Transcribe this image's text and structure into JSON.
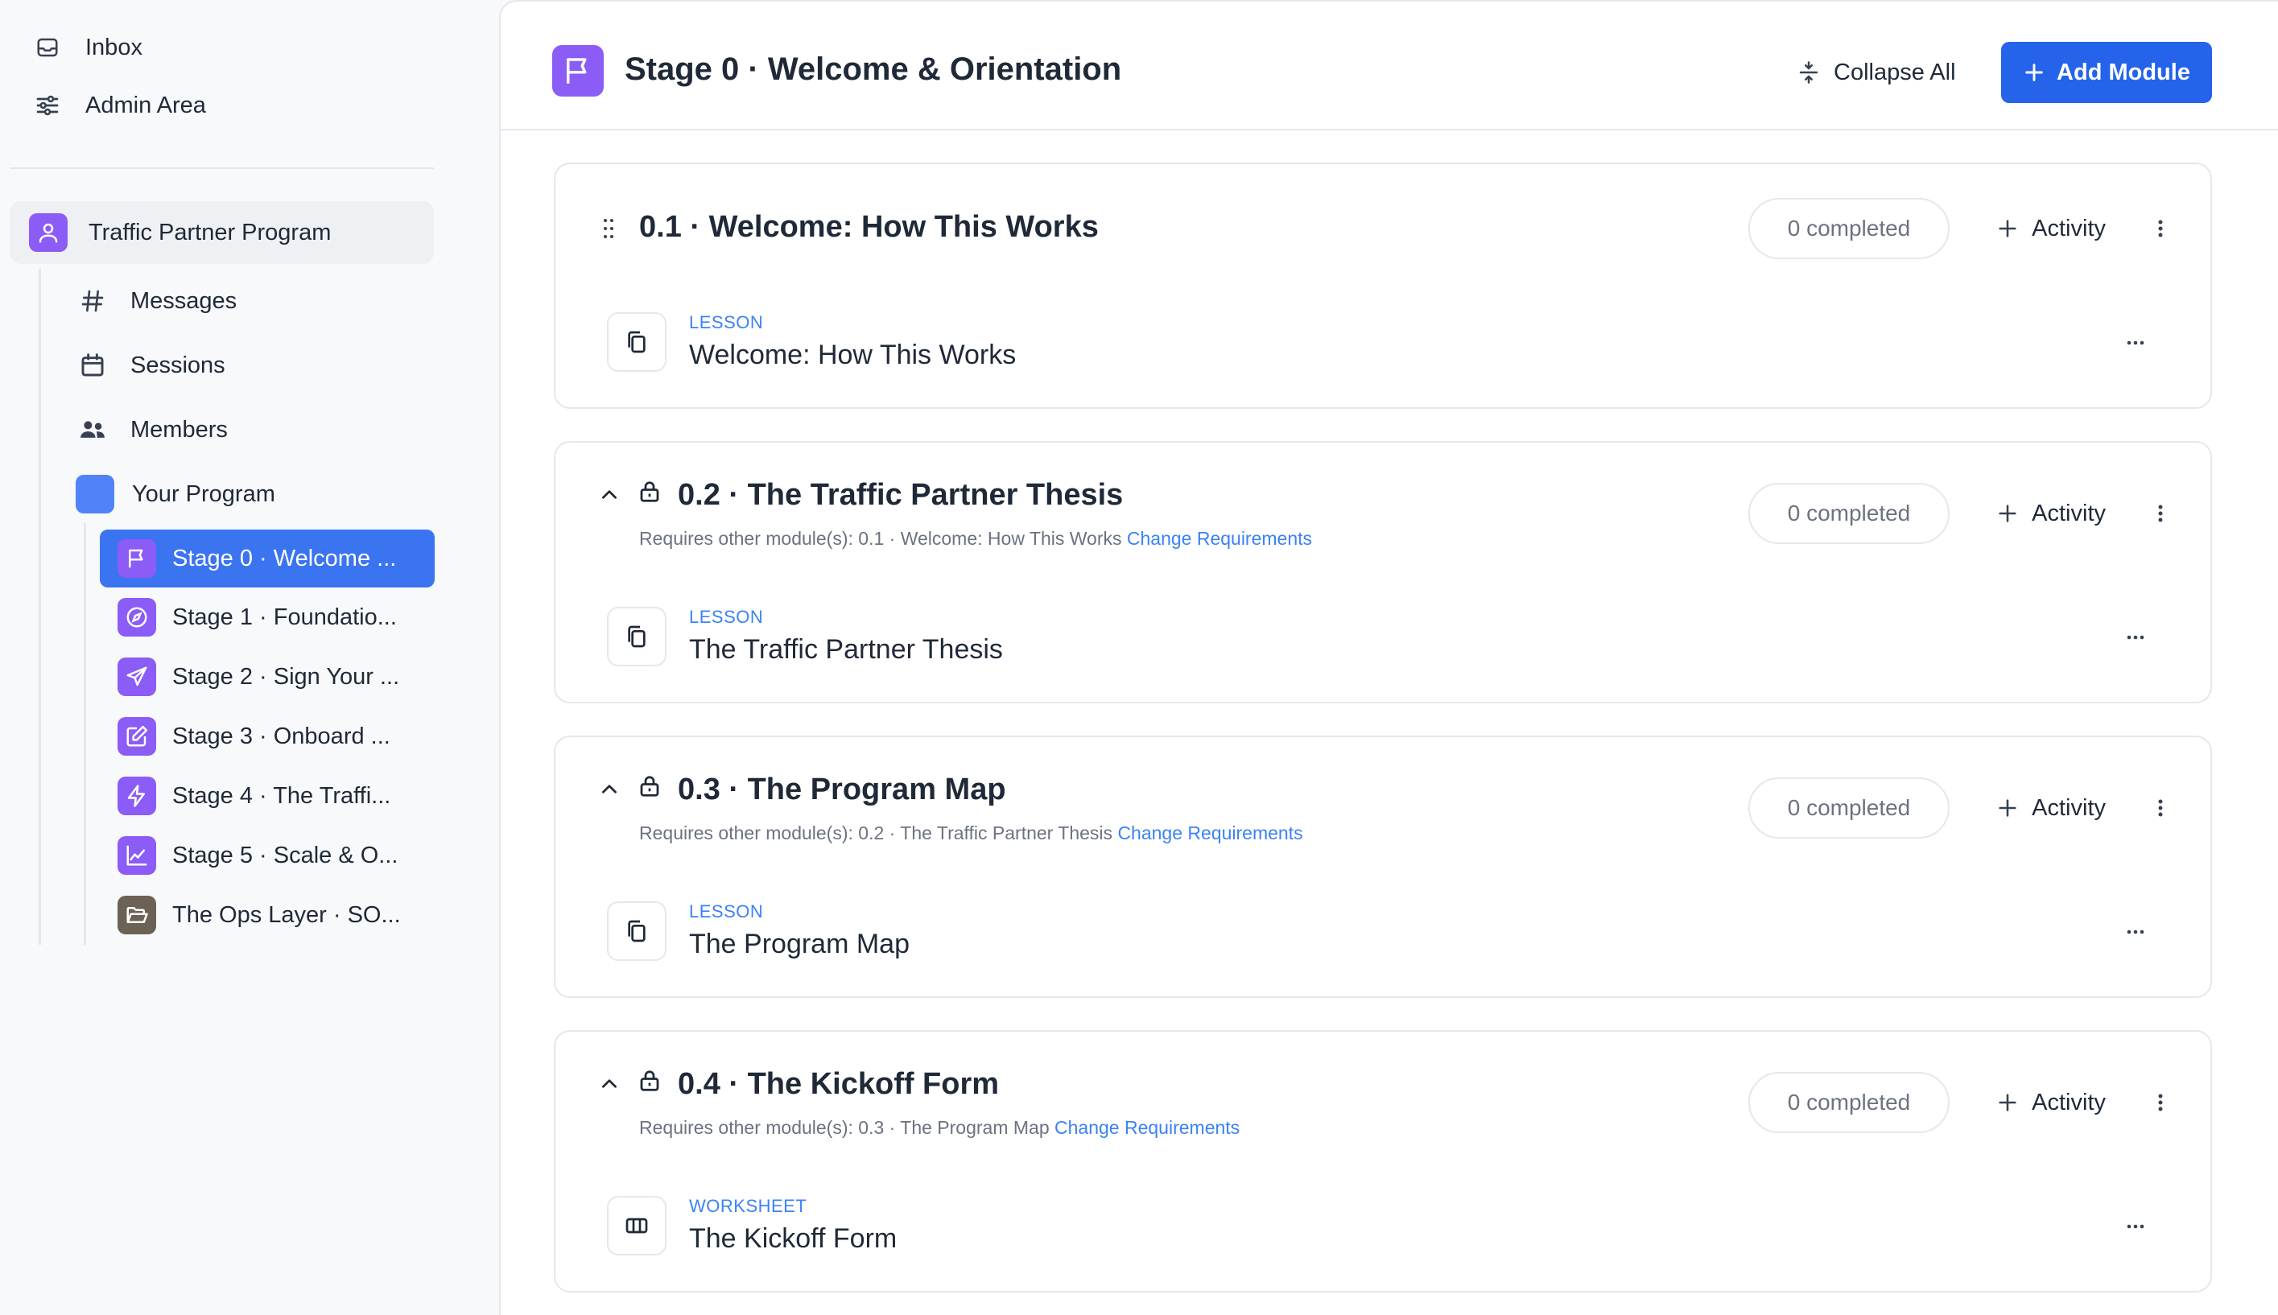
{
  "sidebar": {
    "top_items": [
      {
        "label": "Inbox",
        "icon": "inbox-icon"
      },
      {
        "label": "Admin Area",
        "icon": "sliders-icon"
      }
    ],
    "program": {
      "label": "Traffic Partner Program",
      "icon": "user-icon"
    },
    "nav": [
      {
        "label": "Messages",
        "icon": "hash-icon"
      },
      {
        "label": "Sessions",
        "icon": "calendar-icon"
      },
      {
        "label": "Members",
        "icon": "users-icon"
      },
      {
        "label": "Your Program",
        "icon": "blue-square-icon"
      }
    ],
    "stages": [
      {
        "label": "Stage 0 · Welcome ...",
        "icon": "flag-icon",
        "active": true
      },
      {
        "label": "Stage 1 · Foundatio...",
        "icon": "compass-icon"
      },
      {
        "label": "Stage 2 · Sign Your ...",
        "icon": "send-icon"
      },
      {
        "label": "Stage 3 · Onboard ...",
        "icon": "edit-icon"
      },
      {
        "label": "Stage 4 · The Traffi...",
        "icon": "zap-icon"
      },
      {
        "label": "Stage 5 · Scale & O...",
        "icon": "chart-line-icon"
      },
      {
        "label": "The Ops Layer · SO...",
        "icon": "folder-icon"
      }
    ]
  },
  "header": {
    "title": "Stage 0 · Welcome & Orientation",
    "collapse_label": "Collapse All",
    "add_label": "Add Module"
  },
  "modules": [
    {
      "title": "0.1 · Welcome: How This Works",
      "completed": "0 completed",
      "activity_label": "Activity",
      "requirement": "",
      "req_link": "",
      "item": {
        "kind": "LESSON",
        "title": "Welcome: How This Works"
      }
    },
    {
      "title": "0.2 · The Traffic Partner Thesis",
      "completed": "0 completed",
      "activity_label": "Activity",
      "requirement": "Requires other module(s): 0.1 · Welcome: How This Works",
      "req_link": "Change Requirements",
      "item": {
        "kind": "LESSON",
        "title": "The Traffic Partner Thesis"
      }
    },
    {
      "title": "0.3 · The Program Map",
      "completed": "0 completed",
      "activity_label": "Activity",
      "requirement": "Requires other module(s): 0.2 · The Traffic Partner Thesis",
      "req_link": "Change Requirements",
      "item": {
        "kind": "LESSON",
        "title": "The Program Map"
      }
    },
    {
      "title": "0.4 · The Kickoff Form",
      "completed": "0 completed",
      "activity_label": "Activity",
      "requirement": "Requires other module(s): 0.3 · The Program Map",
      "req_link": "Change Requirements",
      "item": {
        "kind": "WORKSHEET",
        "title": "The Kickoff Form"
      }
    }
  ],
  "colors": {
    "accent": "#2563eb",
    "active_stage": "#3b74f0",
    "stage_icon": "#8b5cf6",
    "link": "#3b82f6"
  }
}
